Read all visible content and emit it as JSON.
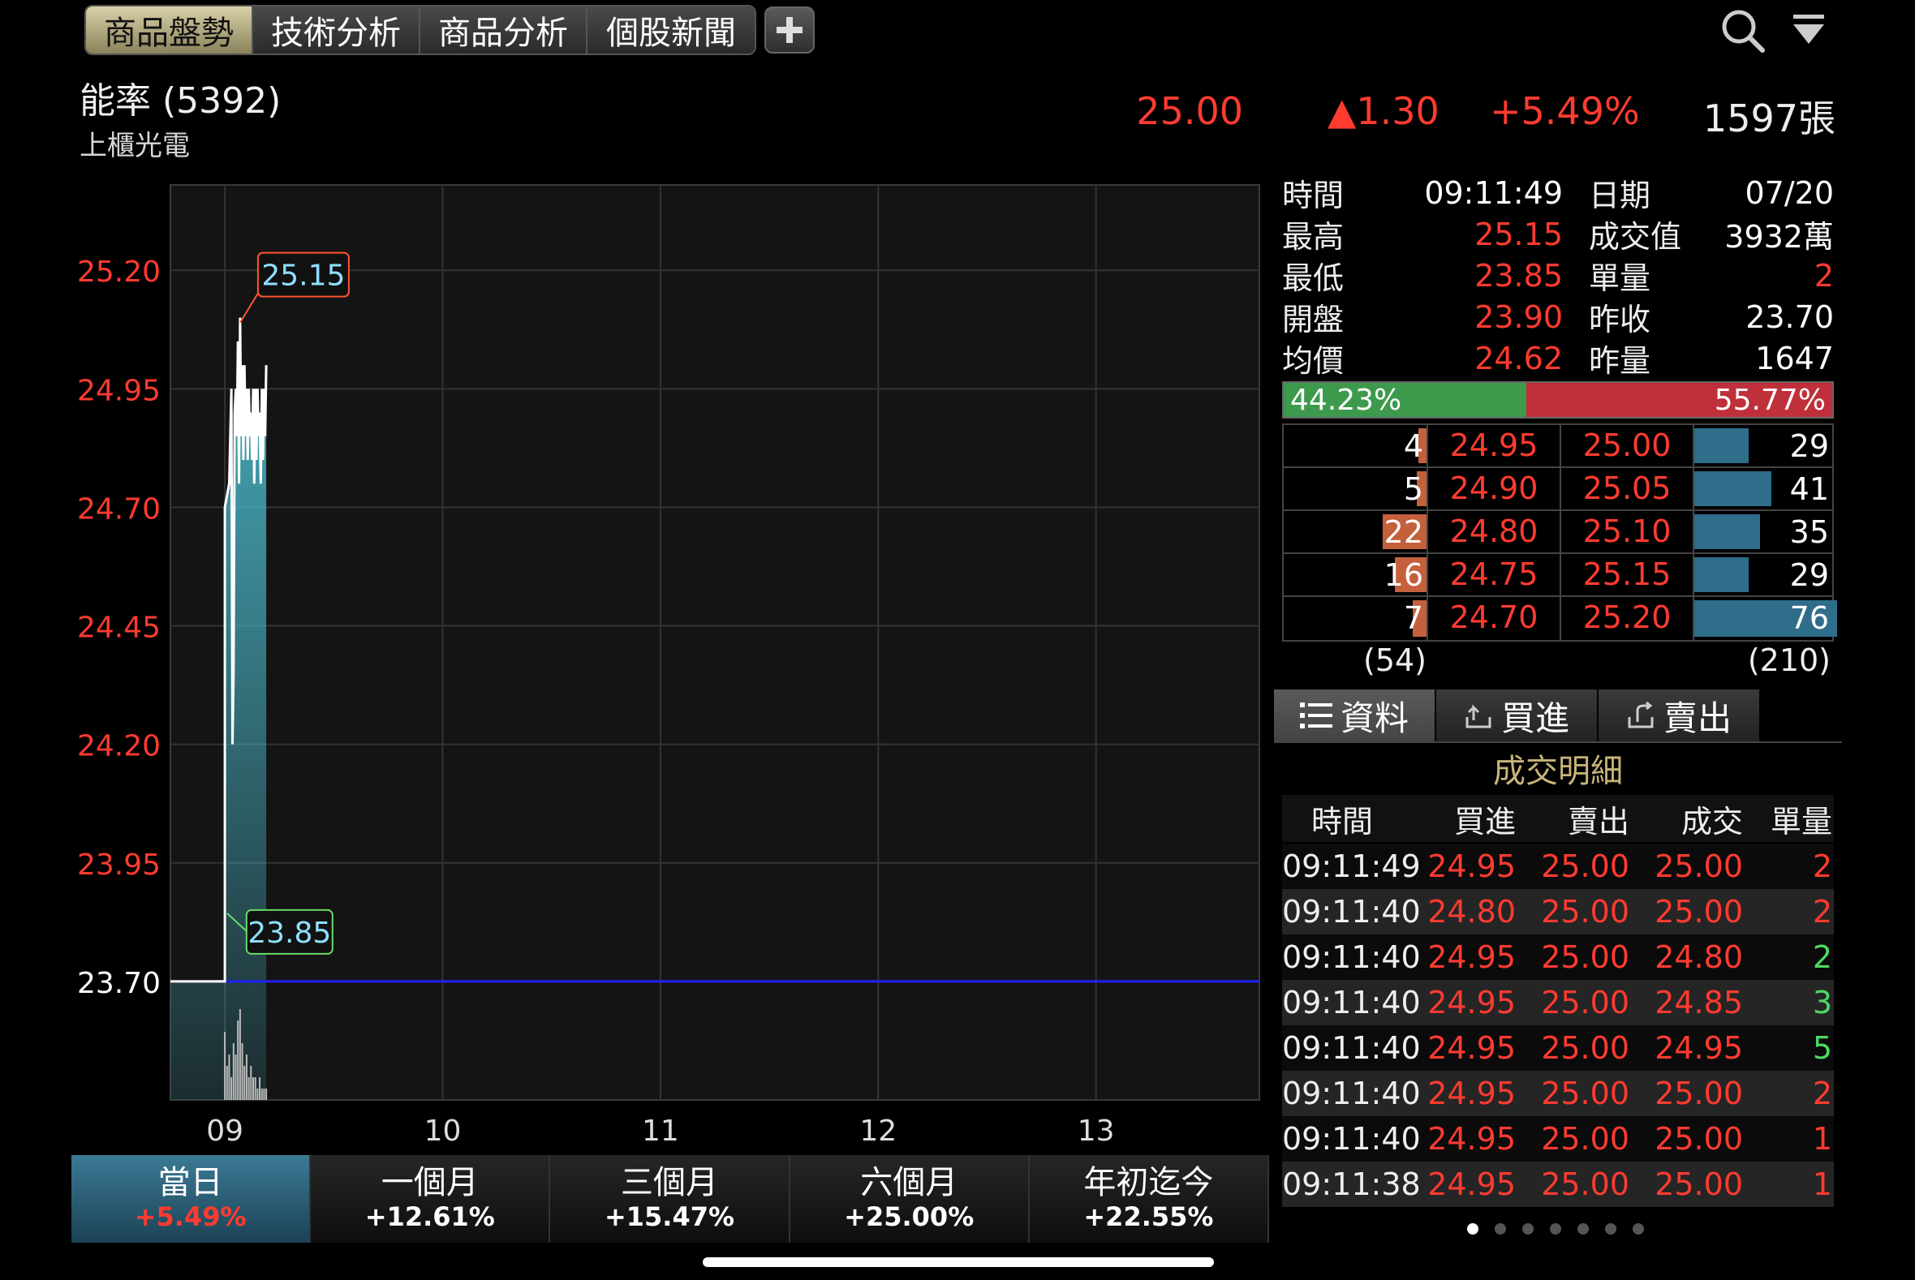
{
  "tabs": [
    "商品盤勢",
    "技術分析",
    "商品分析",
    "個股新聞"
  ],
  "stock": {
    "name": "能率 (5392)",
    "sector": "上櫃光電",
    "price": "25.00",
    "change": "▲1.30",
    "change_pct": "+5.49%",
    "volume": "1597張"
  },
  "info": [
    {
      "k1": "時間",
      "v1": "09:11:49",
      "k2": "日期",
      "v2": "07/20"
    },
    {
      "k1": "最高",
      "v1": "25.15",
      "k2": "成交值",
      "v2": "3932萬"
    },
    {
      "k1": "最低",
      "v1": "23.85",
      "k2": "單量",
      "v2": "2"
    },
    {
      "k1": "開盤",
      "v1": "23.90",
      "k2": "昨收",
      "v2": "23.70"
    },
    {
      "k1": "均價",
      "v1": "24.62",
      "k2": "昨量",
      "v2": "1647"
    }
  ],
  "ratio": {
    "buy_label": "44.23%",
    "sell_label": "55.77%",
    "buy": 0.4423
  },
  "book": [
    {
      "bid_vol": "4",
      "bid": "24.95",
      "ask": "25.00",
      "ask_vol": "29",
      "bid_n": 4,
      "ask_n": 29
    },
    {
      "bid_vol": "5",
      "bid": "24.90",
      "ask": "25.05",
      "ask_vol": "41",
      "bid_n": 5,
      "ask_n": 41
    },
    {
      "bid_vol": "22",
      "bid": "24.80",
      "ask": "25.10",
      "ask_vol": "35",
      "bid_n": 22,
      "ask_n": 35
    },
    {
      "bid_vol": "16",
      "bid": "24.75",
      "ask": "25.15",
      "ask_vol": "29",
      "bid_n": 16,
      "ask_n": 29
    },
    {
      "bid_vol": "7",
      "bid": "24.70",
      "ask": "25.20",
      "ask_vol": "76",
      "bid_n": 7,
      "ask_n": 76
    }
  ],
  "book_totals": {
    "bid": "(54)",
    "ask": "(210)"
  },
  "detail_tabs": [
    "資料",
    "買進",
    "賣出"
  ],
  "detail_title": "成交明細",
  "detail_head": [
    "時間",
    "買進",
    "賣出",
    "成交",
    "單量"
  ],
  "detail_rows": [
    {
      "t": "09:11:49",
      "b": "24.95",
      "s": "25.00",
      "p": "25.00",
      "v": "2",
      "vc": "red"
    },
    {
      "t": "09:11:40",
      "b": "24.80",
      "s": "25.00",
      "p": "25.00",
      "v": "2",
      "vc": "red"
    },
    {
      "t": "09:11:40",
      "b": "24.95",
      "s": "25.00",
      "p": "24.80",
      "v": "2",
      "vc": "green"
    },
    {
      "t": "09:11:40",
      "b": "24.95",
      "s": "25.00",
      "p": "24.85",
      "v": "3",
      "vc": "green"
    },
    {
      "t": "09:11:40",
      "b": "24.95",
      "s": "25.00",
      "p": "24.95",
      "v": "5",
      "vc": "green"
    },
    {
      "t": "09:11:40",
      "b": "24.95",
      "s": "25.00",
      "p": "25.00",
      "v": "2",
      "vc": "red"
    },
    {
      "t": "09:11:40",
      "b": "24.95",
      "s": "25.00",
      "p": "25.00",
      "v": "1",
      "vc": "red"
    },
    {
      "t": "09:11:38",
      "b": "24.95",
      "s": "25.00",
      "p": "25.00",
      "v": "1",
      "vc": "red"
    }
  ],
  "periods": [
    {
      "label": "當日",
      "value": "+5.49%"
    },
    {
      "label": "一個月",
      "value": "+12.61%"
    },
    {
      "label": "三個月",
      "value": "+15.47%"
    },
    {
      "label": "六個月",
      "value": "+25.00%"
    },
    {
      "label": "年初迄今",
      "value": "+22.55%"
    }
  ],
  "chart_data": {
    "type": "line",
    "y_ticks": [
      "25.20",
      "24.95",
      "24.70",
      "24.45",
      "24.20",
      "23.95",
      "23.70"
    ],
    "y_tick_values": [
      25.2,
      24.95,
      24.7,
      24.45,
      24.2,
      23.95,
      23.7
    ],
    "x_ticks": [
      "09",
      "10",
      "11",
      "12",
      "13"
    ],
    "ylim": [
      23.45,
      25.38
    ],
    "xlim": [
      8.75,
      13.75
    ],
    "prev_close": 23.7,
    "high_label": "25.15",
    "low_label": "23.85",
    "price_series": [
      [
        8.75,
        23.7
      ],
      [
        9.0,
        23.7
      ],
      [
        9.0,
        24.7
      ],
      [
        9.02,
        24.75
      ],
      [
        9.03,
        24.95
      ],
      [
        9.035,
        24.2
      ],
      [
        9.04,
        24.35
      ],
      [
        9.045,
        24.9
      ],
      [
        9.05,
        24.95
      ],
      [
        9.055,
        24.85
      ],
      [
        9.06,
        25.05
      ],
      [
        9.065,
        24.75
      ],
      [
        9.07,
        25.1
      ],
      [
        9.075,
        24.85
      ],
      [
        9.08,
        25.0
      ],
      [
        9.085,
        24.8
      ],
      [
        9.09,
        25.0
      ],
      [
        9.095,
        24.85
      ],
      [
        9.1,
        24.95
      ],
      [
        9.105,
        24.8
      ],
      [
        9.11,
        24.95
      ],
      [
        9.115,
        24.85
      ],
      [
        9.12,
        24.9
      ],
      [
        9.125,
        24.8
      ],
      [
        9.13,
        24.95
      ],
      [
        9.135,
        24.75
      ],
      [
        9.14,
        24.95
      ],
      [
        9.145,
        24.8
      ],
      [
        9.15,
        24.95
      ],
      [
        9.155,
        24.85
      ],
      [
        9.16,
        24.9
      ],
      [
        9.165,
        24.75
      ],
      [
        9.17,
        24.95
      ],
      [
        9.175,
        24.8
      ],
      [
        9.18,
        24.95
      ],
      [
        9.185,
        24.85
      ],
      [
        9.19,
        25.0
      ]
    ],
    "volume_series": [
      [
        9.0,
        6
      ],
      [
        9.01,
        3
      ],
      [
        9.02,
        4
      ],
      [
        9.03,
        2
      ],
      [
        9.04,
        5
      ],
      [
        9.05,
        4
      ],
      [
        9.06,
        7
      ],
      [
        9.07,
        8
      ],
      [
        9.08,
        5
      ],
      [
        9.09,
        3
      ],
      [
        9.1,
        4
      ],
      [
        9.11,
        2
      ],
      [
        9.12,
        3
      ],
      [
        9.13,
        2
      ],
      [
        9.14,
        2
      ],
      [
        9.15,
        1
      ],
      [
        9.16,
        2
      ],
      [
        9.17,
        1
      ],
      [
        9.18,
        1
      ],
      [
        9.19,
        1
      ]
    ],
    "colors": {
      "price_up": "#ff3b30",
      "line": "#ffffff",
      "fill": "#4bb7c9",
      "prev_close": "#2020ff"
    }
  }
}
